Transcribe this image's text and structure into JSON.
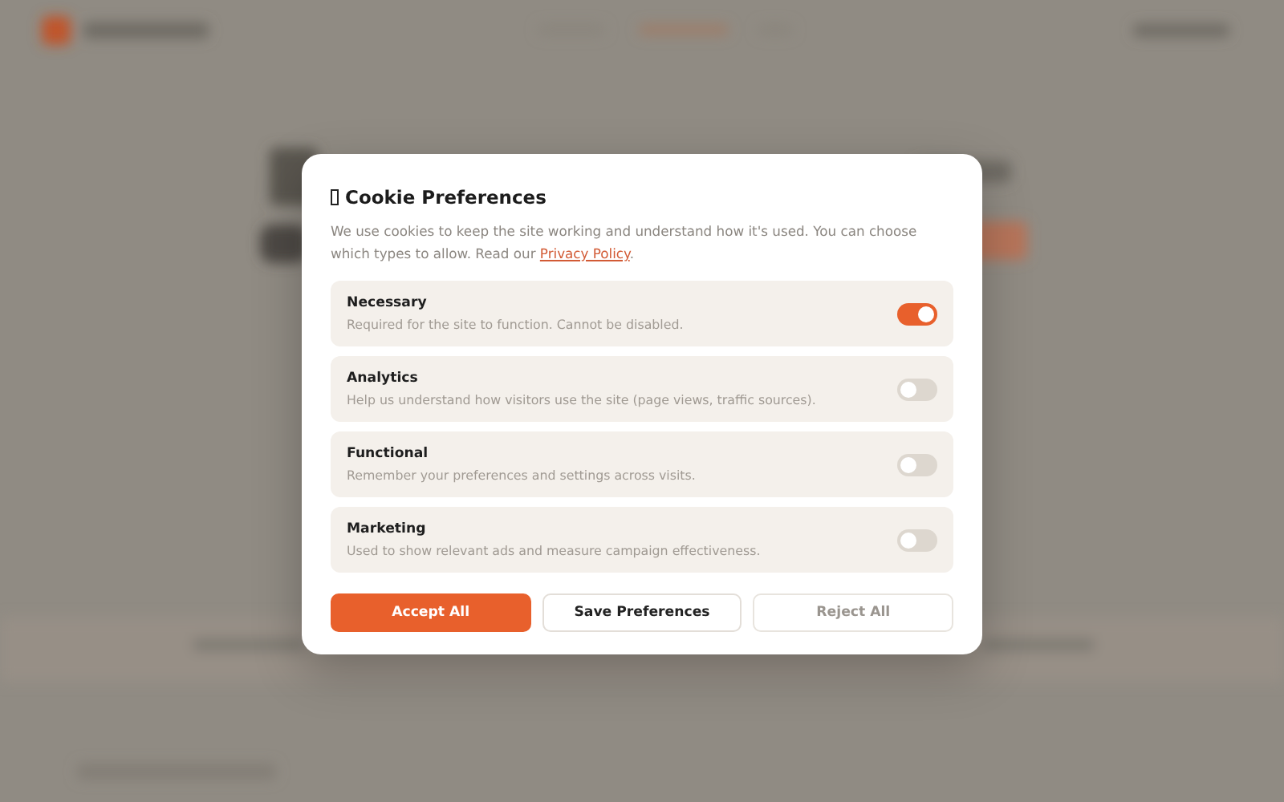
{
  "dialog": {
    "title": "Cookie Preferences",
    "description": "We use cookies to keep the site working and understand how it's used. You can choose which types to allow. Read our ",
    "link": "Privacy Policy",
    "description_end": ".",
    "categories": [
      {
        "name": "Necessary",
        "description": "Required for the site to function. Cannot be disabled.",
        "on": true
      },
      {
        "name": "Analytics",
        "description": "Help us understand how visitors use the site (page views, traffic sources).",
        "on": false
      },
      {
        "name": "Functional",
        "description": "Remember your preferences and settings across visits.",
        "on": false
      },
      {
        "name": "Marketing",
        "description": "Used to show relevant ads and measure campaign effectiveness.",
        "on": false
      }
    ],
    "buttons": [
      {
        "label": "Accept All",
        "kind": "primary"
      },
      {
        "label": "Save Preferences",
        "kind": "secondary"
      },
      {
        "label": "Reject All",
        "kind": "muted"
      }
    ]
  }
}
